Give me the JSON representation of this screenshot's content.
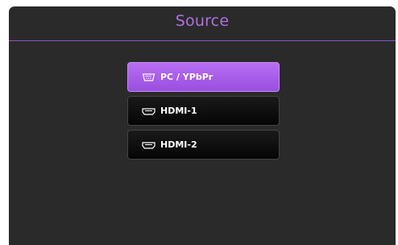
{
  "menu": {
    "title": "Source",
    "accent_color": "#b070e0",
    "selected_index": 0,
    "items": [
      {
        "label": "PC / YPbPr",
        "icon": "vga-port-icon",
        "selected": true
      },
      {
        "label": "HDMI-1",
        "icon": "hdmi-port-icon",
        "selected": false
      },
      {
        "label": "HDMI-2",
        "icon": "hdmi-port-icon",
        "selected": false
      }
    ]
  }
}
